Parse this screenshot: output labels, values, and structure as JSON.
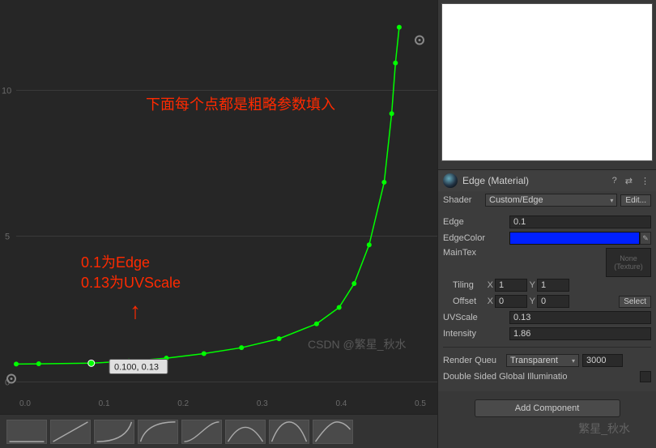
{
  "curve": {
    "annotation_top": "下面每个点都是粗略参数填入",
    "annotation_mid1": "0.1为Edge",
    "annotation_mid2": "0.13为UVScale",
    "tooltip": "0.100, 0.13",
    "y_ticks": [
      "0",
      "5",
      "10"
    ],
    "x_ticks": [
      "0.0",
      "0.1",
      "0.2",
      "0.3",
      "0.4",
      "0.5"
    ]
  },
  "chart_data": {
    "type": "line",
    "title": "",
    "xlabel": "",
    "ylabel": "",
    "xlim": [
      0,
      0.55
    ],
    "ylim": [
      -0.5,
      12
    ],
    "x": [
      0.0,
      0.03,
      0.1,
      0.15,
      0.2,
      0.25,
      0.3,
      0.35,
      0.4,
      0.43,
      0.45,
      0.47,
      0.49,
      0.5,
      0.505,
      0.51
    ],
    "y": [
      0.1,
      0.11,
      0.13,
      0.2,
      0.3,
      0.45,
      0.65,
      0.95,
      1.45,
      2.0,
      2.8,
      4.1,
      6.2,
      8.5,
      10.2,
      11.4
    ],
    "selected_point_index": 2
  },
  "inspector": {
    "header_title": "Edge (Material)",
    "shader_label": "Shader",
    "shader_value": "Custom/Edge",
    "edit_btn": "Edit...",
    "edge_label": "Edge",
    "edge_value": "0.1",
    "edgecolor_label": "EdgeColor",
    "edgecolor_value": "#0020ff",
    "maintex_label": "MainTex",
    "maintex_none": "None",
    "maintex_none2": "(Texture)",
    "tiling_label": "Tiling",
    "tiling_x": "1",
    "tiling_y": "1",
    "offset_label": "Offset",
    "offset_x": "0",
    "offset_y": "0",
    "select_btn": "Select",
    "uvscale_label": "UVScale",
    "uvscale_value": "0.13",
    "intensity_label": "Intensity",
    "intensity_value": "1.86",
    "renderqueue_label": "Render Queu",
    "renderqueue_dd": "Transparent",
    "renderqueue_value": "3000",
    "dsgi_label": "Double Sided Global Illuminatio",
    "add_component": "Add Component"
  },
  "watermark_a": "繁星_秋水",
  "watermark_b": "CSDN @繁星_秋水"
}
